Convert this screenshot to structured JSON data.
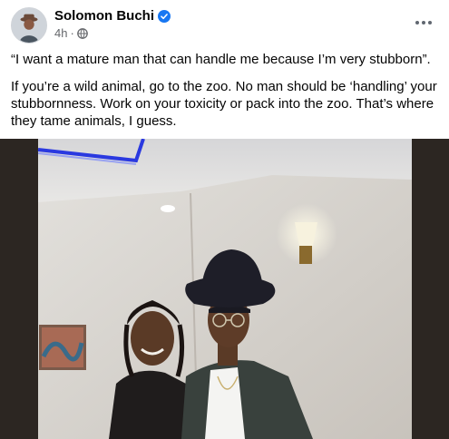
{
  "post": {
    "author": "Solomon Buchi",
    "verified": true,
    "time": "4h",
    "audience_icon": "globe-icon",
    "more_icon": "more-options-icon",
    "quote": "“I want a mature man that can handle me because I’m very stubborn”.",
    "body": "If you’re a wild animal, go to the zoo. No man should be ‘handling’ your stubbornness. Work on your toxicity or pack into the zoo. That’s where they tame animals, I guess."
  },
  "colors": {
    "verified_blue": "#1877f2",
    "meta_gray": "#65676b",
    "photo_border": "#2c2622"
  }
}
